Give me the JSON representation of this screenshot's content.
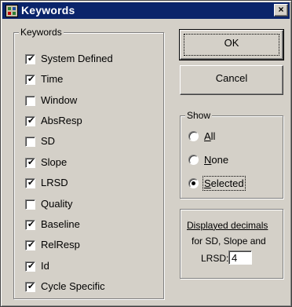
{
  "window": {
    "title": "Keywords",
    "close_glyph": "×",
    "icon": "app-icon"
  },
  "keywords": {
    "legend": "Keywords",
    "items": [
      {
        "label": "System Defined",
        "checked": true
      },
      {
        "label": "Time",
        "checked": true
      },
      {
        "label": "Window",
        "checked": false
      },
      {
        "label": "AbsResp",
        "checked": true
      },
      {
        "label": "SD",
        "checked": false
      },
      {
        "label": "Slope",
        "checked": true
      },
      {
        "label": "LRSD",
        "checked": true
      },
      {
        "label": "Quality",
        "checked": false
      },
      {
        "label": "Baseline",
        "checked": true
      },
      {
        "label": "RelResp",
        "checked": true
      },
      {
        "label": "Id",
        "checked": true
      },
      {
        "label": "Cycle Specific",
        "checked": true
      }
    ]
  },
  "buttons": {
    "ok": "OK",
    "cancel": "Cancel"
  },
  "show": {
    "legend": "Show",
    "options": [
      {
        "accel": "A",
        "rest": "ll",
        "selected": false
      },
      {
        "accel": "N",
        "rest": "one",
        "selected": false
      },
      {
        "accel": "S",
        "rest": "elected",
        "selected": true
      }
    ]
  },
  "decimals": {
    "line1": "Displayed decimals",
    "line2": "for SD, Slope and",
    "line3": "LRSD:",
    "value": "4"
  }
}
